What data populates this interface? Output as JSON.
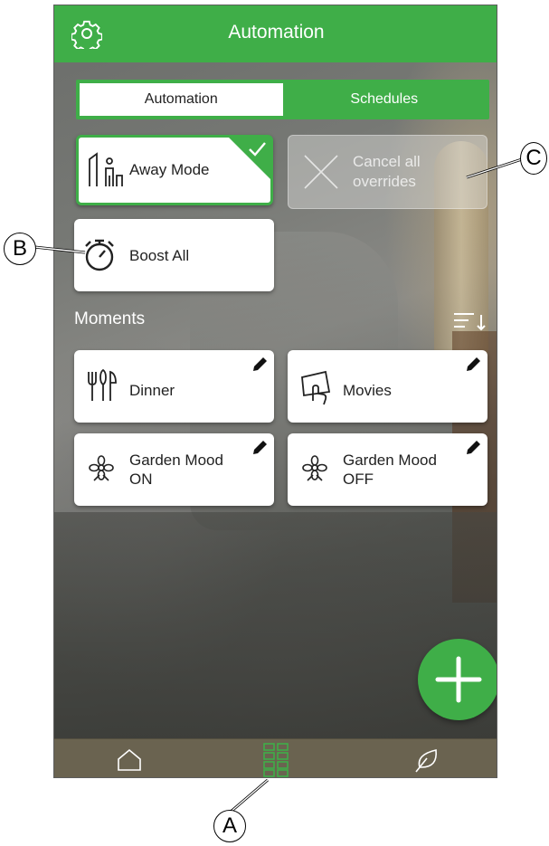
{
  "header": {
    "title": "Automation",
    "settings_icon": "gear-icon"
  },
  "tabs": [
    {
      "label": "Automation",
      "active": true
    },
    {
      "label": "Schedules",
      "active": false
    }
  ],
  "actions": {
    "away_mode": {
      "label": "Away Mode",
      "icon": "away-mode-icon",
      "checked": true
    },
    "cancel_overrides": {
      "label_line1": "Cancel all",
      "label_line2": "overrides",
      "icon": "cancel-x-icon",
      "disabled": true
    },
    "boost_all": {
      "label": "Boost All",
      "icon": "stopwatch-icon"
    }
  },
  "moments": {
    "section_label": "Moments",
    "sort_icon": "sort-icon",
    "items": [
      {
        "label_line1": "Dinner",
        "label_line2": "",
        "icon": "cutlery-icon"
      },
      {
        "label_line1": "Movies",
        "label_line2": "",
        "icon": "tablet-touch-icon"
      },
      {
        "label_line1": "Garden Mood",
        "label_line2": "ON",
        "icon": "flower-icon"
      },
      {
        "label_line1": "Garden Mood",
        "label_line2": "OFF",
        "icon": "flower-icon"
      }
    ]
  },
  "fab": {
    "icon": "plus-icon"
  },
  "bottom_nav": [
    {
      "icon": "home-icon",
      "active": false
    },
    {
      "icon": "grid-icon",
      "active": true
    },
    {
      "icon": "leaf-icon",
      "active": false
    }
  ],
  "callouts": {
    "a": "A",
    "b": "B",
    "c": "C"
  },
  "colors": {
    "accent": "#3fae48",
    "nav_bg": "#6a6350"
  }
}
